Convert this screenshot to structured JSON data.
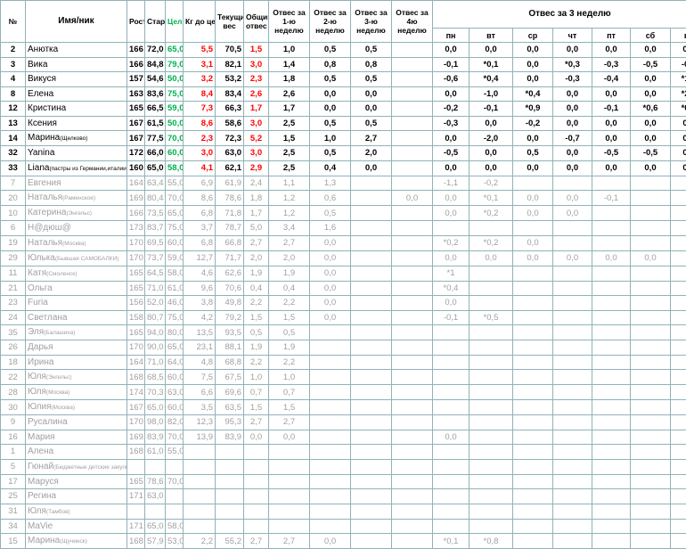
{
  "headers": {
    "num": "№",
    "name": "Имя/ник",
    "height": "Рост",
    "start": "Старт. вес",
    "goal": "Цель",
    "kg_to_goal": "Кг до цели",
    "current": "Текущий вес",
    "total_loss": "Общий отвес",
    "week1": "Отвес за 1-ю неделю",
    "week2": "Отвес за 2-ю неделю",
    "week3": "Отвес за 3-ю неделю",
    "week4": "Отвес за 4ю неделю",
    "week3_days": "Отвес за 3 неделю",
    "days": [
      "пн",
      "вт",
      "ср",
      "чт",
      "пт",
      "сб",
      "вс"
    ]
  },
  "rows": [
    {
      "active": true,
      "num": "2",
      "name": "Анютка",
      "note": "",
      "h": "166",
      "start": "72,0",
      "goal": "65,0",
      "kg": "5,5",
      "cur": "70,5",
      "total": "1,5",
      "w1": "1,0",
      "w2": "0,5",
      "w3": "0,5",
      "w4": "",
      "d": [
        "0,0",
        "0,0",
        "0,0",
        "0,0",
        "0,0",
        "0,0",
        "0,0"
      ]
    },
    {
      "active": true,
      "num": "3",
      "name": "Вика",
      "note": "",
      "h": "166",
      "start": "84,8",
      "goal": "79,0",
      "kg": "3,1",
      "cur": "82,1",
      "total": "3,0",
      "w1": "1,4",
      "w2": "0,8",
      "w3": "0,8",
      "w4": "",
      "d": [
        "-0,1",
        "*0,1",
        "0,0",
        "*0,3",
        "-0,3",
        "-0,5",
        "-0,3"
      ]
    },
    {
      "active": true,
      "num": "4",
      "name": "Викуся",
      "note": "",
      "h": "157",
      "start": "54,6",
      "goal": "50,0",
      "kg": "3,2",
      "cur": "53,2",
      "total": "2,3",
      "w1": "1,8",
      "w2": "0,5",
      "w3": "0,5",
      "w4": "",
      "d": [
        "-0,6",
        "*0,4",
        "0,0",
        "-0,3",
        "-0,4",
        "0,0",
        "*1,8"
      ]
    },
    {
      "active": true,
      "num": "8",
      "name": "Елена",
      "note": "",
      "h": "163",
      "start": "83,6",
      "goal": "75,0",
      "kg": "8,4",
      "cur": "83,4",
      "total": "2,6",
      "w1": "2,6",
      "w2": "0,0",
      "w3": "0,0",
      "w4": "",
      "d": [
        "0,0",
        "-1,0",
        "*0,4",
        "0,0",
        "0,0",
        "0,0",
        "*2,5"
      ]
    },
    {
      "active": true,
      "num": "12",
      "name": "Кристина",
      "note": "",
      "h": "165",
      "start": "66,5",
      "goal": "59,0",
      "kg": "7,3",
      "cur": "66,3",
      "total": "1,7",
      "w1": "1,7",
      "w2": "0,0",
      "w3": "0,0",
      "w4": "",
      "d": [
        "-0,2",
        "-0,1",
        "*0,9",
        "0,0",
        "-0,1",
        "*0,6",
        "*0,3"
      ]
    },
    {
      "active": true,
      "num": "13",
      "name": "Ксения",
      "note": "",
      "h": "167",
      "start": "61,5",
      "goal": "50,0",
      "kg": "8,6",
      "cur": "58,6",
      "total": "3,0",
      "w1": "2,5",
      "w2": "0,5",
      "w3": "0,5",
      "w4": "",
      "d": [
        "-0,3",
        "0,0",
        "-0,2",
        "0,0",
        "0,0",
        "0,0",
        "0,0"
      ]
    },
    {
      "active": true,
      "num": "14",
      "name": "Марина",
      "note": "(Щелково)",
      "h": "167",
      "start": "77,5",
      "goal": "70,0",
      "kg": "2,3",
      "cur": "72,3",
      "total": "5,2",
      "w1": "1,5",
      "w2": "1,0",
      "w3": "2,7",
      "w4": "",
      "d": [
        "0,0",
        "-2,0",
        "0,0",
        "-0,7",
        "0,0",
        "0,0",
        "0,0"
      ]
    },
    {
      "active": true,
      "num": "32",
      "name": "Yanina",
      "note": "",
      "h": "172",
      "start": "66,0",
      "goal": "60,0",
      "kg": "3,0",
      "cur": "63,0",
      "total": "3,0",
      "w1": "2,5",
      "w2": "0,5",
      "w3": "2,0",
      "w4": "",
      "d": [
        "-0,5",
        "0,0",
        "0,5",
        "0,0",
        "-0,5",
        "-0,5",
        "0,0"
      ]
    },
    {
      "active": true,
      "num": "33",
      "name": "Liana",
      "note": "(пастры из Германии,италии)",
      "h": "160",
      "start": "65,0",
      "goal": "58,0",
      "kg": "4,1",
      "cur": "62,1",
      "total": "2,9",
      "w1": "2,5",
      "w2": "0,4",
      "w3": "0,0",
      "w4": "",
      "d": [
        "0,0",
        "0,0",
        "0,0",
        "0,0",
        "0,0",
        "0,0",
        "0,0"
      ]
    },
    {
      "active": false,
      "num": "7",
      "name": "Евгения",
      "note": "",
      "h": "164",
      "start": "63,4",
      "goal": "55,0",
      "kg": "6,9",
      "cur": "61,9",
      "total": "2,4",
      "w1": "1,1",
      "w2": "1,3",
      "w3": "",
      "w4": "",
      "d": [
        "-1,1",
        "-0,2",
        "",
        "",
        "",
        "",
        ""
      ]
    },
    {
      "active": false,
      "num": "20",
      "name": "Наталья",
      "note": "(Раменское)",
      "h": "169",
      "start": "80,4",
      "goal": "70,0",
      "kg": "8,6",
      "cur": "78,6",
      "total": "1,8",
      "w1": "1,2",
      "w2": "0,6",
      "w3": "",
      "w4": "0,0",
      "d": [
        "0,0",
        "*0,1",
        "0,0",
        "0,0",
        "-0,1",
        "",
        ""
      ]
    },
    {
      "active": false,
      "num": "10",
      "name": "Катерина",
      "note": "(Энгельс)",
      "h": "166",
      "start": "73,5",
      "goal": "65,0",
      "kg": "6,8",
      "cur": "71,8",
      "total": "1,7",
      "w1": "1,2",
      "w2": "0,5",
      "w3": "",
      "w4": "",
      "d": [
        "0,0",
        "*0,2",
        "0,0",
        "0,0",
        "",
        "",
        ""
      ]
    },
    {
      "active": false,
      "num": "6",
      "name": "Н@дюш@",
      "note": "",
      "h": "173",
      "start": "83,7",
      "goal": "75,0",
      "kg": "3,7",
      "cur": "78,7",
      "total": "5,0",
      "w1": "3,4",
      "w2": "1,6",
      "w3": "",
      "w4": "",
      "d": [
        "",
        "",
        "",
        "",
        "",
        "",
        ""
      ]
    },
    {
      "active": false,
      "num": "19",
      "name": "Наталья",
      "note": "(Москва)",
      "h": "170",
      "start": "69,5",
      "goal": "60,0",
      "kg": "6,8",
      "cur": "66,8",
      "total": "2,7",
      "w1": "2,7",
      "w2": "0,0",
      "w3": "",
      "w4": "",
      "d": [
        "*0,2",
        "*0,2",
        "0,0",
        "",
        "",
        "",
        ""
      ]
    },
    {
      "active": false,
      "num": "29",
      "name": "Юлька",
      "note": "(Бывшая САМОБАЛКИ)",
      "h": "170",
      "start": "73,7",
      "goal": "59,0",
      "kg": "12,7",
      "cur": "71,7",
      "total": "2,0",
      "w1": "2,0",
      "w2": "0,0",
      "w3": "",
      "w4": "",
      "d": [
        "0,0",
        "0,0",
        "0,0",
        "0,0",
        "0,0",
        "0,0",
        ""
      ]
    },
    {
      "active": false,
      "num": "11",
      "name": "Катя",
      "note": "(Смоленск)",
      "h": "165",
      "start": "64,5",
      "goal": "58,0",
      "kg": "4,6",
      "cur": "62,6",
      "total": "1,9",
      "w1": "1,9",
      "w2": "0,0",
      "w3": "",
      "w4": "",
      "d": [
        "*1",
        "",
        "",
        "",
        "",
        "",
        ""
      ]
    },
    {
      "active": false,
      "num": "21",
      "name": "Ольга",
      "note": "",
      "h": "165",
      "start": "71,0",
      "goal": "61,0",
      "kg": "9,6",
      "cur": "70,6",
      "total": "0,4",
      "w1": "0,4",
      "w2": "0,0",
      "w3": "",
      "w4": "",
      "d": [
        "*0,4",
        "",
        "",
        "",
        "",
        "",
        ""
      ]
    },
    {
      "active": false,
      "num": "23",
      "name": "Furia",
      "note": "",
      "h": "156",
      "start": "52,0",
      "goal": "46,0",
      "kg": "3,8",
      "cur": "49,8",
      "total": "2,2",
      "w1": "2,2",
      "w2": "0,0",
      "w3": "",
      "w4": "",
      "d": [
        "0,0",
        "",
        "",
        "",
        "",
        "",
        ""
      ]
    },
    {
      "active": false,
      "num": "24",
      "name": "Светлана",
      "note": "",
      "h": "158",
      "start": "80,7",
      "goal": "75,0",
      "kg": "4,2",
      "cur": "79,2",
      "total": "1,5",
      "w1": "1,5",
      "w2": "0,0",
      "w3": "",
      "w4": "",
      "d": [
        "-0,1",
        "*0,5",
        "",
        "",
        "",
        "",
        ""
      ]
    },
    {
      "active": false,
      "num": "35",
      "name": "Эля",
      "note": "(Балашиха)",
      "h": "165",
      "start": "94,0",
      "goal": "80,0",
      "kg": "13,5",
      "cur": "93,5",
      "total": "0,5",
      "w1": "0,5",
      "w2": "",
      "w3": "",
      "w4": "",
      "d": [
        "",
        "",
        "",
        "",
        "",
        "",
        ""
      ]
    },
    {
      "active": false,
      "num": "26",
      "name": "Дарья",
      "note": "",
      "h": "170",
      "start": "90,0",
      "goal": "65,0",
      "kg": "23,1",
      "cur": "88,1",
      "total": "1,9",
      "w1": "1,9",
      "w2": "",
      "w3": "",
      "w4": "",
      "d": [
        "",
        "",
        "",
        "",
        "",
        "",
        ""
      ]
    },
    {
      "active": false,
      "num": "18",
      "name": "Ирина",
      "note": "",
      "h": "164",
      "start": "71,0",
      "goal": "64,0",
      "kg": "4,8",
      "cur": "68,8",
      "total": "2,2",
      "w1": "2,2",
      "w2": "",
      "w3": "",
      "w4": "",
      "d": [
        "",
        "",
        "",
        "",
        "",
        "",
        ""
      ]
    },
    {
      "active": false,
      "num": "22",
      "name": "Юля",
      "note": "(Энгельс)",
      "h": "168",
      "start": "68,5",
      "goal": "60,0",
      "kg": "7,5",
      "cur": "67,5",
      "total": "1,0",
      "w1": "1,0",
      "w2": "",
      "w3": "",
      "w4": "",
      "d": [
        "",
        "",
        "",
        "",
        "",
        "",
        ""
      ]
    },
    {
      "active": false,
      "num": "28",
      "name": "Юля",
      "note": "(Москва)",
      "h": "174",
      "start": "70,3",
      "goal": "63,0",
      "kg": "6,6",
      "cur": "69,6",
      "total": "0,7",
      "w1": "0,7",
      "w2": "",
      "w3": "",
      "w4": "",
      "d": [
        "",
        "",
        "",
        "",
        "",
        "",
        ""
      ]
    },
    {
      "active": false,
      "num": "30",
      "name": "Юлия",
      "note": "(Москва)",
      "h": "167",
      "start": "65,0",
      "goal": "60,0",
      "kg": "3,5",
      "cur": "63,5",
      "total": "1,5",
      "w1": "1,5",
      "w2": "",
      "w3": "",
      "w4": "",
      "d": [
        "",
        "",
        "",
        "",
        "",
        "",
        ""
      ]
    },
    {
      "active": false,
      "num": "9",
      "name": "Русалина",
      "note": "",
      "h": "170",
      "start": "98,0",
      "goal": "82,0",
      "kg": "12,3",
      "cur": "95,3",
      "total": "2,7",
      "w1": "2,7",
      "w2": "",
      "w3": "",
      "w4": "",
      "d": [
        "",
        "",
        "",
        "",
        "",
        "",
        ""
      ]
    },
    {
      "active": false,
      "num": "16",
      "name": "Мария",
      "note": "",
      "h": "169",
      "start": "83,9",
      "goal": "70,0",
      "kg": "13,9",
      "cur": "83,9",
      "total": "0,0",
      "w1": "0,0",
      "w2": "",
      "w3": "",
      "w4": "",
      "d": [
        "0,0",
        "",
        "",
        "",
        "",
        "",
        ""
      ]
    },
    {
      "active": false,
      "num": "1",
      "name": "Алена",
      "note": "",
      "h": "168",
      "start": "61,0",
      "goal": "55,0",
      "kg": "",
      "cur": "",
      "total": "",
      "w1": "",
      "w2": "",
      "w3": "",
      "w4": "",
      "d": [
        "",
        "",
        "",
        "",
        "",
        "",
        ""
      ]
    },
    {
      "active": false,
      "num": "5",
      "name": "Гюнай",
      "note": "(Бюджетные детские закупки)",
      "h": "",
      "start": "",
      "goal": "",
      "kg": "",
      "cur": "",
      "total": "",
      "w1": "",
      "w2": "",
      "w3": "",
      "w4": "",
      "d": [
        "",
        "",
        "",
        "",
        "",
        "",
        ""
      ]
    },
    {
      "active": false,
      "num": "17",
      "name": "Маруся",
      "note": "",
      "h": "165",
      "start": "78,6",
      "goal": "70,0",
      "kg": "",
      "cur": "",
      "total": "",
      "w1": "",
      "w2": "",
      "w3": "",
      "w4": "",
      "d": [
        "",
        "",
        "",
        "",
        "",
        "",
        ""
      ]
    },
    {
      "active": false,
      "num": "25",
      "name": "Регина",
      "note": "",
      "h": "171",
      "start": "63,0",
      "goal": "",
      "kg": "",
      "cur": "",
      "total": "",
      "w1": "",
      "w2": "",
      "w3": "",
      "w4": "",
      "d": [
        "",
        "",
        "",
        "",
        "",
        "",
        ""
      ]
    },
    {
      "active": false,
      "num": "31",
      "name": "Юля",
      "note": "(Тамбов)",
      "h": "",
      "start": "",
      "goal": "",
      "kg": "",
      "cur": "",
      "total": "",
      "w1": "",
      "w2": "",
      "w3": "",
      "w4": "",
      "d": [
        "",
        "",
        "",
        "",
        "",
        "",
        ""
      ]
    },
    {
      "active": false,
      "num": "34",
      "name": "MaVie",
      "note": "",
      "h": "171",
      "start": "65,0",
      "goal": "58,0",
      "kg": "",
      "cur": "",
      "total": "",
      "w1": "",
      "w2": "",
      "w3": "",
      "w4": "",
      "d": [
        "",
        "",
        "",
        "",
        "",
        "",
        ""
      ]
    },
    {
      "active": false,
      "num": "15",
      "name": "Марина",
      "note": "(Щучинск)",
      "h": "168",
      "start": "57,9",
      "goal": "53,0",
      "kg": "2,2",
      "cur": "55,2",
      "total": "2,7",
      "w1": "2,7",
      "w2": "0,0",
      "w3": "",
      "w4": "",
      "d": [
        "*0,1",
        "*0,8",
        "",
        "",
        "",
        "",
        ""
      ]
    }
  ]
}
